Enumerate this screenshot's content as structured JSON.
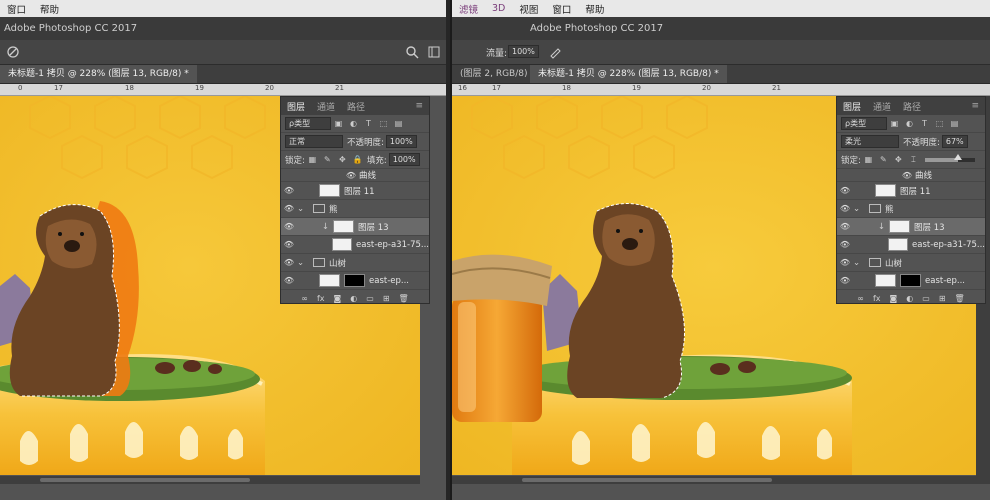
{
  "left": {
    "menu": [
      "窗口",
      "帮助"
    ],
    "app_title": "Adobe Photoshop CC 2017",
    "tabs": [
      {
        "label": "未标题-1 拷贝 @ 228% (图层 13, RGB/8) *",
        "active": true
      }
    ],
    "ruler_ticks": [
      "0",
      "17",
      "18",
      "19",
      "20",
      "21"
    ],
    "panel": {
      "tabs": [
        "图层",
        "通道",
        "路径"
      ],
      "filter_label": "ρ类型",
      "blend_mode": "正常",
      "opacity_label": "不透明度:",
      "opacity_value": "100%",
      "lock_label": "锁定:",
      "fill_label": "填充:",
      "fill_value": "100%",
      "layers": [
        {
          "name": "曲线",
          "kind": "adjust",
          "indent": 2
        },
        {
          "name": "图层 11",
          "kind": "layer",
          "indent": 1
        },
        {
          "name": "熊",
          "kind": "folder",
          "indent": 1
        },
        {
          "name": "图层 13",
          "kind": "layer",
          "indent": 2,
          "selected": true
        },
        {
          "name": "east-ep-a31-75...",
          "kind": "layer",
          "indent": 2
        },
        {
          "name": "山树",
          "kind": "folder",
          "indent": 1
        },
        {
          "name": "east-ep...",
          "kind": "masked",
          "indent": 2
        }
      ],
      "footer_icons": [
        "link-icon",
        "fx-icon",
        "mask-icon",
        "adjustment-icon",
        "folder-icon",
        "new-layer-icon",
        "trash-icon"
      ]
    }
  },
  "right": {
    "menu": [
      "滤镜",
      "3D",
      "视图",
      "窗口",
      "帮助"
    ],
    "app_title": "Adobe Photoshop CC 2017",
    "flow_label": "流量:",
    "flow_value": "100%",
    "tabs": [
      {
        "label": "(图层 2, RGB/8) *",
        "active": false
      },
      {
        "label": "未标题-1 拷贝 @ 228% (图层 13, RGB/8) *",
        "active": true
      }
    ],
    "ruler_ticks": [
      "16",
      "17",
      "18",
      "19",
      "20",
      "21"
    ],
    "panel": {
      "tabs": [
        "图层",
        "通道",
        "路径"
      ],
      "filter_label": "ρ类型",
      "blend_mode": "柔光",
      "opacity_label": "不透明度:",
      "opacity_value": "67%",
      "opacity_fraction": 0.67,
      "lock_label": "锁定:",
      "layers": [
        {
          "name": "曲线",
          "kind": "adjust",
          "indent": 2
        },
        {
          "name": "图层 11",
          "kind": "layer",
          "indent": 1
        },
        {
          "name": "熊",
          "kind": "folder",
          "indent": 1
        },
        {
          "name": "图层 13",
          "kind": "layer",
          "indent": 2,
          "selected": true
        },
        {
          "name": "east-ep-a31-75...",
          "kind": "layer",
          "indent": 2
        },
        {
          "name": "山树",
          "kind": "folder",
          "indent": 1
        },
        {
          "name": "east-ep...",
          "kind": "masked",
          "indent": 2
        }
      ]
    }
  },
  "colors": {
    "canvas_yellow": "#f2c12e",
    "ui_dark": "#535353",
    "bear_brown": "#6b4424"
  }
}
